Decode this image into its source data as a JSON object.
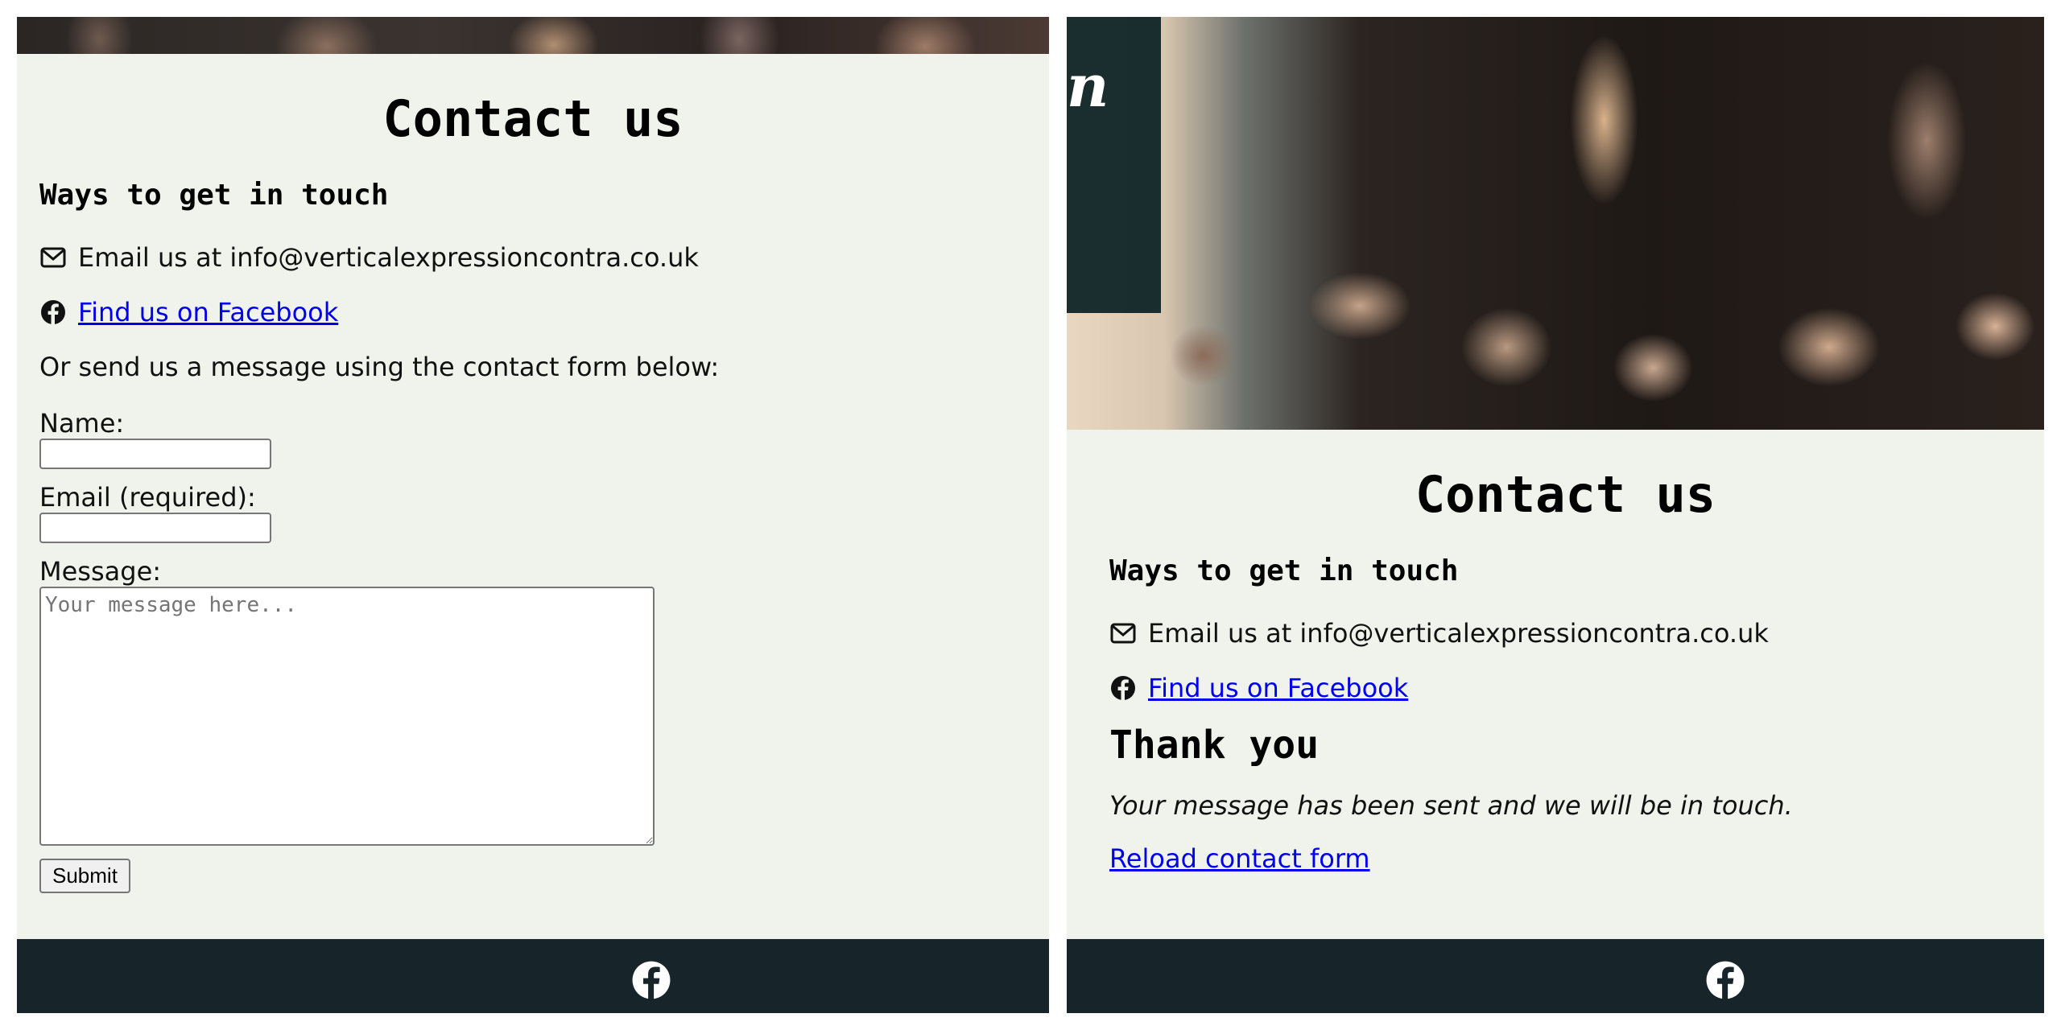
{
  "left": {
    "title": "Contact us",
    "subtitle": "Ways to get in touch",
    "email_text": "Email us at info@verticalexpressioncontra.co.uk",
    "facebook_link": "Find us on Facebook",
    "form_intro": "Or send us a message using the contact form below:",
    "form": {
      "name_label": "Name:",
      "email_label": "Email (required):",
      "message_label": "Message:",
      "message_placeholder": "Your message here...",
      "submit_label": "Submit"
    }
  },
  "right": {
    "brand_fragment": "n",
    "title": "Contact us",
    "subtitle": "Ways to get in touch",
    "email_text": "Email us at info@verticalexpressioncontra.co.uk",
    "facebook_link": "Find us on Facebook",
    "thank_title": "Thank you",
    "thank_message": "Your message has been sent and we will be in touch.",
    "reload_link": "Reload contact form"
  },
  "icons": {
    "email": "envelope-icon",
    "facebook": "facebook-icon",
    "footer": "facebook-icon"
  },
  "colors": {
    "page_bg": "#eff3ec",
    "footer_bg": "#17242a",
    "link": "#0000ee",
    "overlay": "#092023"
  }
}
